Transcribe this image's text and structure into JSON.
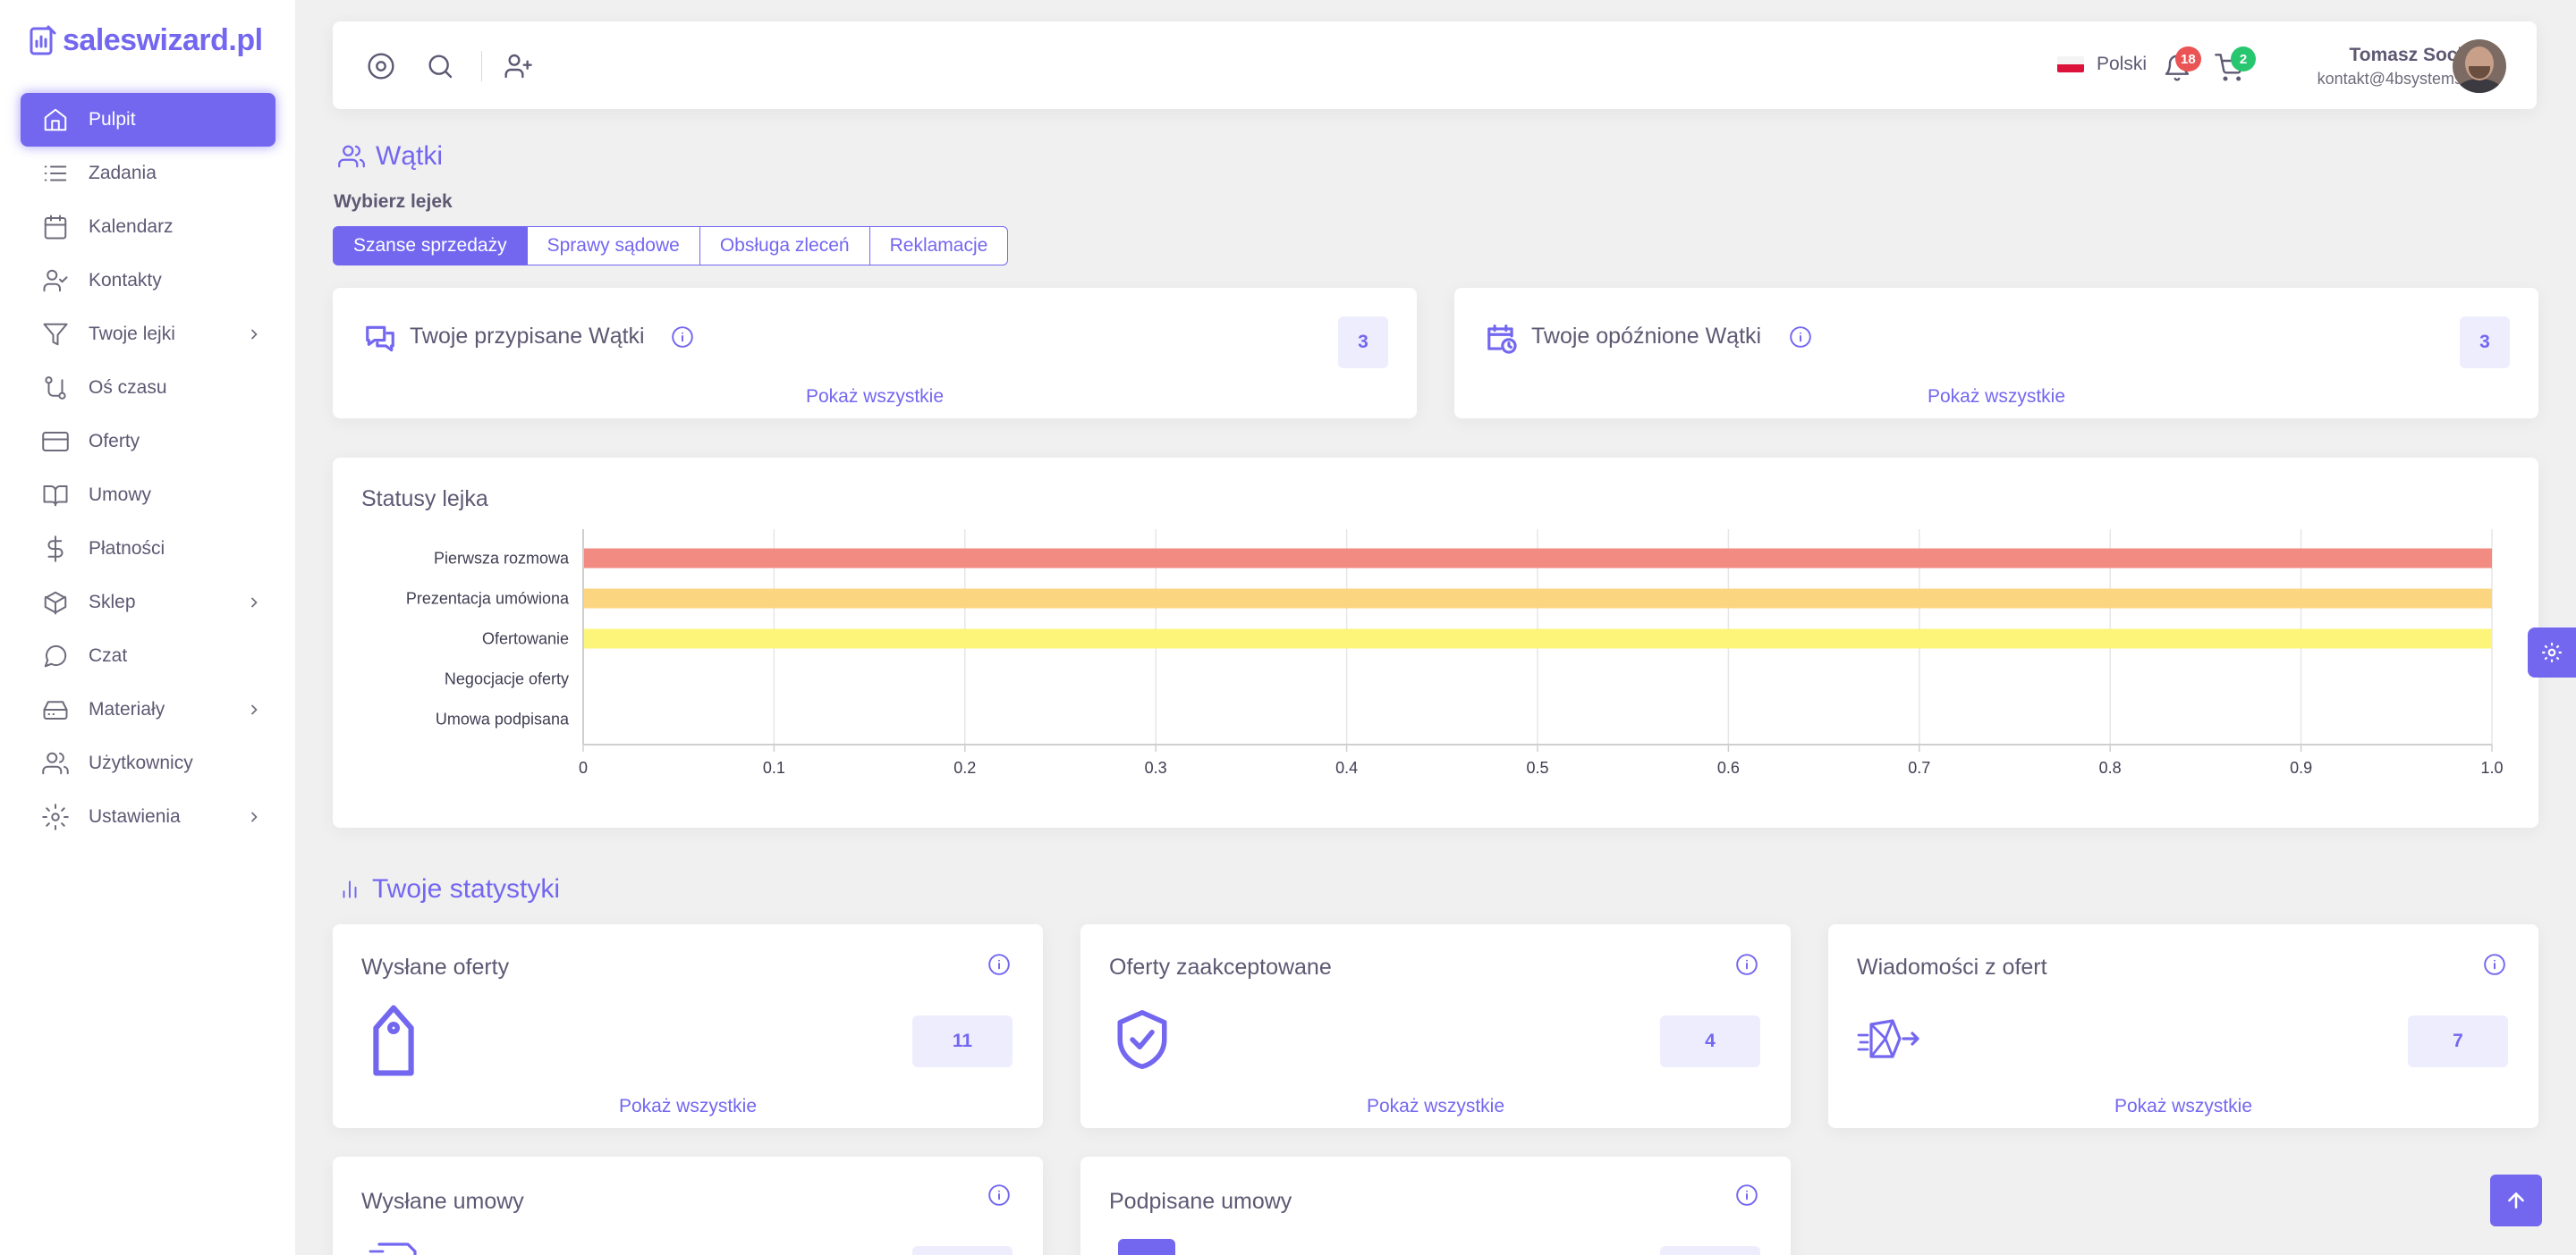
{
  "brand": {
    "name": "saleswizard.pl",
    "accent": "#7367f0"
  },
  "sidebar": {
    "items": [
      {
        "label": "Pulpit",
        "icon": "home-icon",
        "active": true
      },
      {
        "label": "Zadania",
        "icon": "list-icon"
      },
      {
        "label": "Kalendarz",
        "icon": "calendar-icon"
      },
      {
        "label": "Kontakty",
        "icon": "user-check-icon"
      },
      {
        "label": "Twoje lejki",
        "icon": "filter-icon",
        "submenu": true
      },
      {
        "label": "Oś czasu",
        "icon": "git-pull-icon"
      },
      {
        "label": "Oferty",
        "icon": "credit-card-icon"
      },
      {
        "label": "Umowy",
        "icon": "book-open-icon"
      },
      {
        "label": "Płatności",
        "icon": "dollar-icon"
      },
      {
        "label": "Sklep",
        "icon": "box-icon",
        "submenu": true
      },
      {
        "label": "Czat",
        "icon": "message-circle-icon"
      },
      {
        "label": "Materiały",
        "icon": "hard-drive-icon",
        "submenu": true
      },
      {
        "label": "Użytkownicy",
        "icon": "users-icon"
      },
      {
        "label": "Ustawienia",
        "icon": "settings-icon",
        "submenu": true
      }
    ]
  },
  "topbar": {
    "language": "Polski",
    "notifications": "18",
    "cart": "2",
    "user": {
      "name": "Tomasz Socha",
      "email": "kontakt@4bsystems.pl"
    }
  },
  "threads": {
    "title": "Wątki",
    "funnel_label": "Wybierz lejek",
    "tabs": [
      "Szanse sprzedaży",
      "Sprawy sądowe",
      "Obsługa zleceń",
      "Reklamacje"
    ],
    "assigned": {
      "title": "Twoje przypisane Wątki",
      "count": "3",
      "link": "Pokaż wszystkie"
    },
    "delayed": {
      "title": "Twoje opóźnione Wątki",
      "count": "3",
      "link": "Pokaż wszystkie"
    }
  },
  "funnel_chart_title": "Statusy lejka",
  "chart_data": {
    "type": "bar",
    "orientation": "horizontal",
    "title": "Statusy lejka",
    "categories": [
      "Pierwsza rozmowa",
      "Prezentacja umówiona",
      "Ofertowanie",
      "Negocjacje oferty",
      "Umowa podpisana"
    ],
    "values": [
      1,
      1,
      1,
      0,
      0
    ],
    "colors": [
      "#f28b82",
      "#fcd581",
      "#fdf57a",
      "#a0d2eb",
      "#b8e0b8"
    ],
    "xlim": [
      0,
      1.0
    ],
    "xticks": [
      "0",
      "0.1",
      "0.2",
      "0.3",
      "0.4",
      "0.5",
      "0.6",
      "0.7",
      "0.8",
      "0.9",
      "1.0"
    ],
    "grid": true
  },
  "stats": {
    "title": "Twoje statystyki",
    "cards": [
      {
        "title": "Wysłane oferty",
        "count": "11",
        "link": "Pokaż wszystkie",
        "icon": "tag-icon"
      },
      {
        "title": "Oferty zaakceptowane",
        "count": "4",
        "link": "Pokaż wszystkie",
        "icon": "shield-check-icon"
      },
      {
        "title": "Wiadomości z ofert",
        "count": "7",
        "link": "Pokaż wszystkie",
        "icon": "mail-send-icon"
      },
      {
        "title": "Wysłane umowy",
        "icon": "document-send-icon"
      },
      {
        "title": "Podpisane umowy",
        "icon": "signed-document-icon"
      }
    ]
  }
}
